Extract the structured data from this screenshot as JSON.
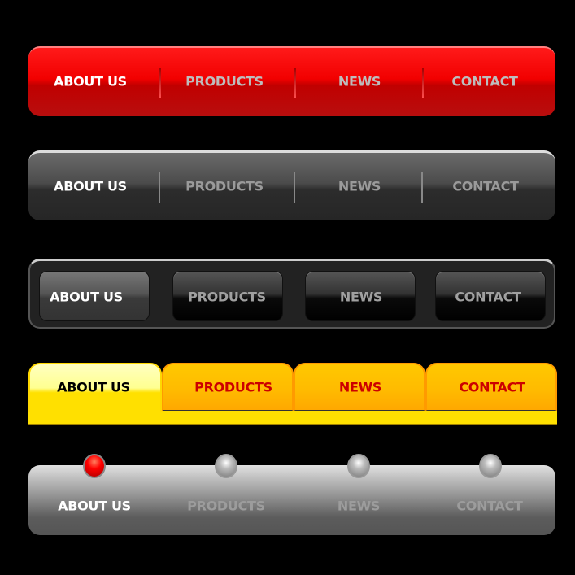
{
  "menus": [
    {
      "style": "red-glossy",
      "items": [
        "ABOUT US",
        "PRODUCTS",
        "NEWS",
        "CONTACT"
      ],
      "active": 0,
      "colors": {
        "active": "#ffffff",
        "inactive": "#bdbdbd"
      }
    },
    {
      "style": "dark-glossy",
      "items": [
        "ABOUT US",
        "PRODUCTS",
        "NEWS",
        "CONTACT"
      ],
      "active": 0,
      "colors": {
        "active": "#ffffff",
        "inactive": "#9a9a9a"
      }
    },
    {
      "style": "dark-buttons",
      "items": [
        "ABOUT US",
        "PRODUCTS",
        "NEWS",
        "CONTACT"
      ],
      "active": 0,
      "colors": {
        "active": "#ffffff",
        "inactive": "#a0a0a0"
      }
    },
    {
      "style": "yellow-tabs",
      "items": [
        "ABOUT US",
        "PRODUCTS",
        "NEWS",
        "CONTACT"
      ],
      "active": 0,
      "colors": {
        "active": "#000000",
        "inactive": "#cc0000"
      }
    },
    {
      "style": "silver-knobs",
      "items": [
        "ABOUT US",
        "PRODUCTS",
        "NEWS",
        "CONTACT"
      ],
      "active": 0,
      "colors": {
        "active": "#ffffff",
        "inactive": "#9c9c9c"
      }
    }
  ]
}
